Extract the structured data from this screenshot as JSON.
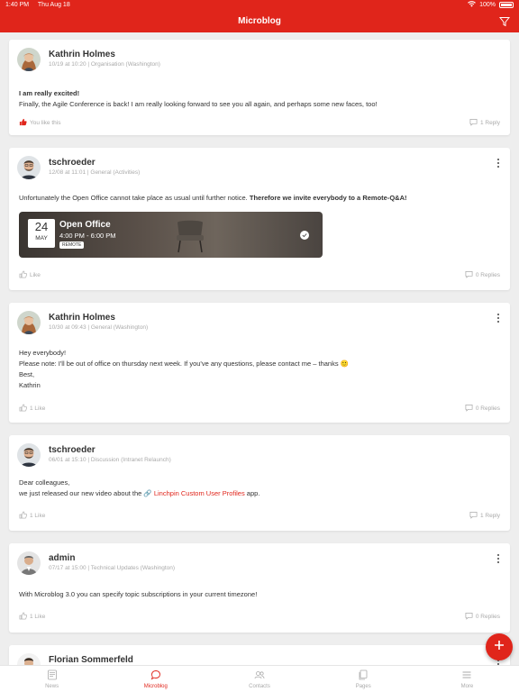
{
  "status": {
    "time": "1:40 PM",
    "date": "Thu Aug 18",
    "battery": "100%"
  },
  "header": {
    "title": "Microblog",
    "accent": "#e0251b"
  },
  "posts": [
    {
      "author": "Kathrin Holmes",
      "meta": "10/19 at 10:20 | Organisation (Washington)",
      "body_bold": "I am really excited!",
      "body_line": "Finally, the Agile Conference is back! I am really looking forward to see you all again, and perhaps some new faces, too!",
      "like": "You like this",
      "reply": "1 Reply"
    },
    {
      "author": "tschroeder",
      "meta": "12/08 at 11:01 | General (Activities)",
      "body_text": "Unfortunately the Open Office cannot take place as usual until further notice. ",
      "body_bold": "Therefore we invite everybody to a Remote-Q&A!",
      "event": {
        "day": "24",
        "month": "MAY",
        "title": "Open Office",
        "time": "4:00 PM - 6:00 PM",
        "badge": "REMOTE"
      },
      "like": "Like",
      "reply": "0 Replies"
    },
    {
      "author": "Kathrin Holmes",
      "meta": "10/30 at 09:43 | General (Washington)",
      "lines": [
        "Hey everybody!",
        "Please note: I'll be out of office on thursday next week. If you've any questions, please contact me – thanks 🙂",
        "Best,",
        "Kathrin"
      ],
      "like": "1 Like",
      "reply": "0 Replies"
    },
    {
      "author": "tschroeder",
      "meta": "06/01 at 15:10 | Discussion (Intranet Relaunch)",
      "line1": "Dear colleagues,",
      "line2_pre": "we just released our new video about the ",
      "line2_link": "🔗 Linchpin Custom User Profiles",
      "line2_post": " app.",
      "like": "1 Like",
      "reply": "1 Reply"
    },
    {
      "author": "admin",
      "meta": "07/17 at 15:00 | Technical Updates (Washington)",
      "body": "With Microblog 3.0 you can specify topic subscriptions in your current timezone!",
      "like": "1 Like",
      "reply": "0 Replies"
    },
    {
      "author": "Florian Sommerfeld"
    }
  ],
  "tabs": [
    {
      "label": "News",
      "icon": "news-icon"
    },
    {
      "label": "Microblog",
      "icon": "microblog-icon",
      "active": true
    },
    {
      "label": "Contacts",
      "icon": "contacts-icon"
    },
    {
      "label": "Pages",
      "icon": "pages-icon"
    },
    {
      "label": "More",
      "icon": "menu-icon"
    }
  ]
}
